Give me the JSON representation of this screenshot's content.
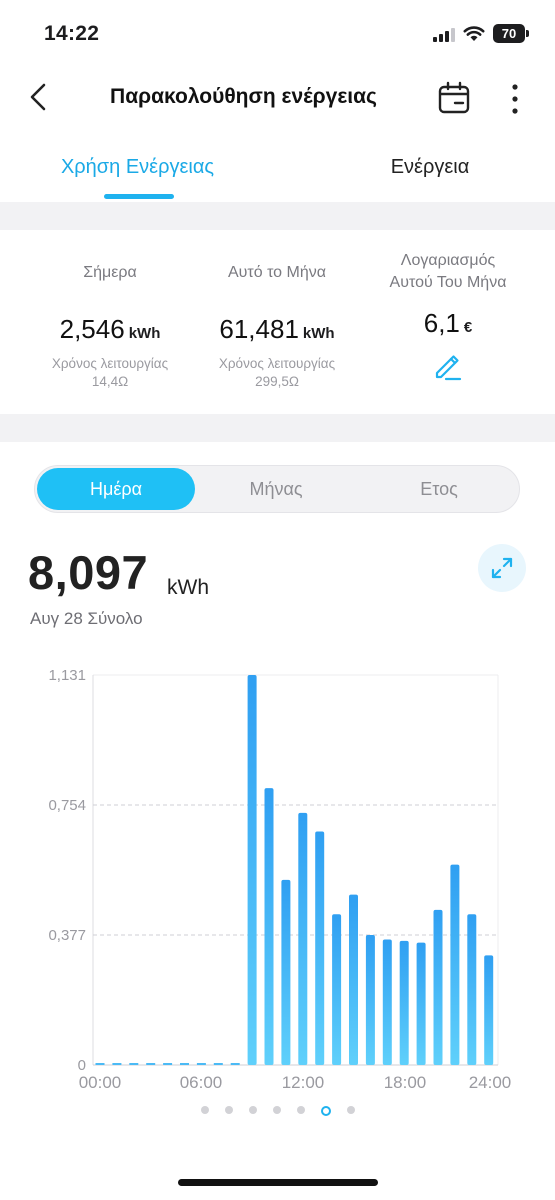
{
  "status_bar": {
    "time": "14:22",
    "battery": "70"
  },
  "header": {
    "title": "Παρακολούθηση ενέργειας"
  },
  "tabs": [
    {
      "label": "Χρήση Ενέργειας",
      "active": true
    },
    {
      "label": "Ενέργεια",
      "active": false
    }
  ],
  "summary": {
    "today": {
      "label": "Σήμερα",
      "value": "2,546",
      "unit": "kWh",
      "runtime_label": "Χρόνος λειτουργίας",
      "runtime": "14,4Ω"
    },
    "month": {
      "label": "Αυτό το Μήνα",
      "value": "61,481",
      "unit": "kWh",
      "runtime_label": "Χρόνος λειτουργίας",
      "runtime": "299,5Ω"
    },
    "bill": {
      "label_line1": "Λογαριασμός",
      "label_line2": "Αυτού Του Μήνα",
      "value": "6,1",
      "unit": "€"
    }
  },
  "period_selector": {
    "options": [
      "Ημέρα",
      "Μήνας",
      "Ετος"
    ],
    "selected": "Ημέρα"
  },
  "total": {
    "value": "8,097",
    "unit": "kWh",
    "caption": "Αυγ 28 Σύνολο"
  },
  "chart_data": {
    "type": "bar",
    "y_tick_labels": [
      "1,131",
      "0,754",
      "0,377",
      "0"
    ],
    "y_ticks": [
      1.131,
      0.754,
      0.377,
      0
    ],
    "ylim": [
      0,
      1.131
    ],
    "x_tick_labels": [
      "00:00",
      "06:00",
      "12:00",
      "18:00",
      "24:00"
    ],
    "categories": [
      "00",
      "01",
      "02",
      "03",
      "04",
      "05",
      "06",
      "07",
      "08",
      "09",
      "10",
      "11",
      "12",
      "13",
      "14",
      "15",
      "16",
      "17",
      "18",
      "19",
      "20",
      "21",
      "22",
      "23"
    ],
    "values": [
      0,
      0,
      0,
      0,
      0,
      0,
      0,
      0,
      0,
      1.131,
      0.803,
      0.537,
      0.731,
      0.677,
      0.437,
      0.494,
      0.377,
      0.364,
      0.36,
      0.355,
      0.45,
      0.581,
      0.437,
      0.318
    ],
    "grid": true,
    "bar_color_top": "#2f9ff2",
    "bar_color_bottom": "#5fd0fb"
  },
  "pager": {
    "count": 7,
    "active_index": 5
  },
  "colors": {
    "accent": "#1fb2ef",
    "segment_active": "#1fc0f5"
  }
}
